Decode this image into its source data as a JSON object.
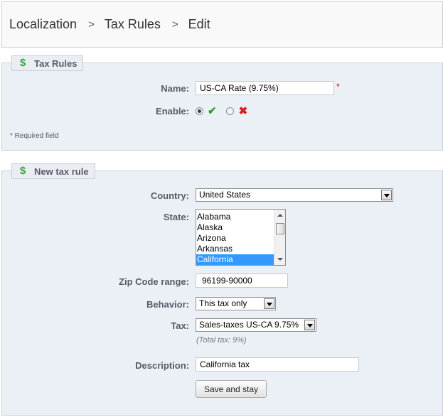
{
  "breadcrumb": {
    "items": [
      "Localization",
      "Tax Rules",
      "Edit"
    ],
    "separator": ">"
  },
  "tax_rules_panel": {
    "legend": "Tax Rules",
    "name_label": "Name:",
    "name_value": "US-CA Rate (9.75%)",
    "required_mark": "*",
    "enable_label": "Enable:",
    "enable_yes_selected": true,
    "required_note": "* Required field"
  },
  "new_rule_panel": {
    "legend": "New tax rule",
    "country_label": "Country:",
    "country_value": "United States",
    "state_label": "State:",
    "states": [
      "Alabama",
      "Alaska",
      "Arizona",
      "Arkansas",
      "California"
    ],
    "selected_state": "California",
    "zip_label": "Zip Code range:",
    "zip_value": "96199-90000",
    "behavior_label": "Behavior:",
    "behavior_value": "This tax only",
    "tax_label": "Tax:",
    "tax_value": "Sales-taxes US-CA 9.75%",
    "total_tax_hint": "(Total tax: 9%)",
    "description_label": "Description:",
    "description_value": "California tax",
    "save_button": "Save and stay"
  },
  "colors": {
    "panel_bg": "#ebf0f6",
    "dollar_icon": "#3aa63a",
    "check_icon": "#2e9e2e",
    "cross_icon": "#d42020",
    "selected_option": "#3399ff"
  },
  "icons": {
    "legend": "dollar-icon",
    "enable_yes": "check-icon",
    "enable_no": "cross-icon"
  }
}
